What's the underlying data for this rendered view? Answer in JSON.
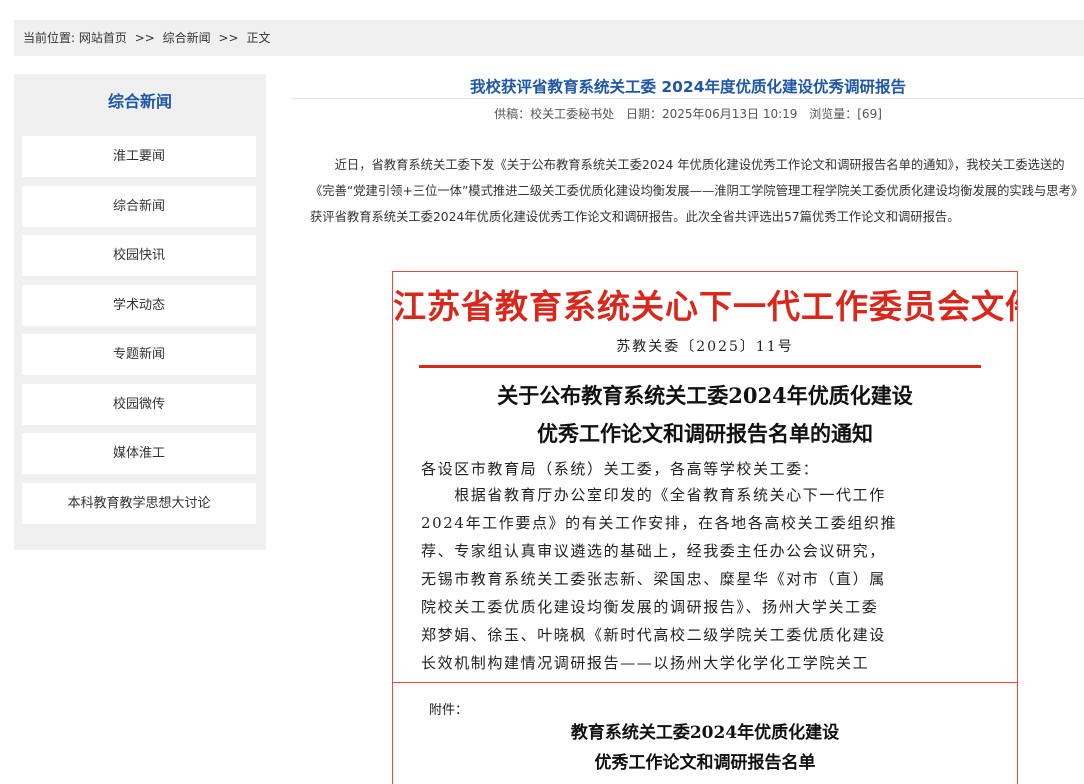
{
  "breadcrumb": {
    "prefix": "当前位置:",
    "home": "网站首页",
    "separator": ">>",
    "section": "综合新闻",
    "current": "正文"
  },
  "sidebar": {
    "title": "综合新闻",
    "items": [
      {
        "label": "淮工要闻"
      },
      {
        "label": "综合新闻"
      },
      {
        "label": "校园快讯"
      },
      {
        "label": "学术动态"
      },
      {
        "label": "专题新闻"
      },
      {
        "label": "校园微传"
      },
      {
        "label": "媒体淮工"
      },
      {
        "label": "本科教育教学思想大讨论"
      }
    ]
  },
  "article": {
    "title": "我校获评省教育系统关工委 2024年度优质化建设优秀调研报告",
    "meta": {
      "source": "供稿：校关工委秘书处",
      "date": "日期：2025年06月13日 10:19",
      "views": "浏览量：[69]"
    },
    "body": "近日，省教育系统关工委下发《关于公布教育系统关工委2024 年优质化建设优秀工作论文和调研报告名单的通知》，我校关工委选送的《完善“党建引领+三位一体”模式推进二级关工委优质化建设均衡发展——淮阴工学院管理工程学院关工委优质化建设均衡发展的实践与思考》获评省教育系统关工委2024年优质化建设优秀工作论文和调研报告。此次全省共评选出57篇优秀工作论文和调研报告。"
  },
  "document": {
    "header": "江苏省教育系统关心下一代工作委员会文件",
    "number": "苏教关委〔2025〕11号",
    "title_line1": "关于公布教育系统关工委2024年优质化建设",
    "title_line2": "优秀工作论文和调研报告名单的通知",
    "body_lines": [
      "各设区市教育局（系统）关工委，各高等学校关工委：",
      "　　根据省教育厅办公室印发的《全省教育系统关心下一代工作",
      "2024年工作要点》的有关工作安排，在各地各高校关工委组织推",
      "荐、专家组认真审议遴选的基础上，经我委主任办公会议研究，",
      "无锡市教育系统关工委张志新、梁国忠、糜星华《对市（直）属",
      "院校关工委优质化建设均衡发展的调研报告》、扬州大学关工委",
      "郑梦娟、徐玉、叶晓枫《新时代高校二级学院关工委优质化建设",
      "长效机制构建情况调研报告——以扬州大学化学化工学院关工"
    ],
    "attachment_label": "附件：",
    "attachment_title_line1": "教育系统关工委2024年优质化建设",
    "attachment_title_line2": "优秀工作论文和调研报告名单"
  },
  "colors": {
    "accent_blue": "#1f57a6",
    "document_red": "#d9271c",
    "panel_gray": "#f0f0f0"
  }
}
